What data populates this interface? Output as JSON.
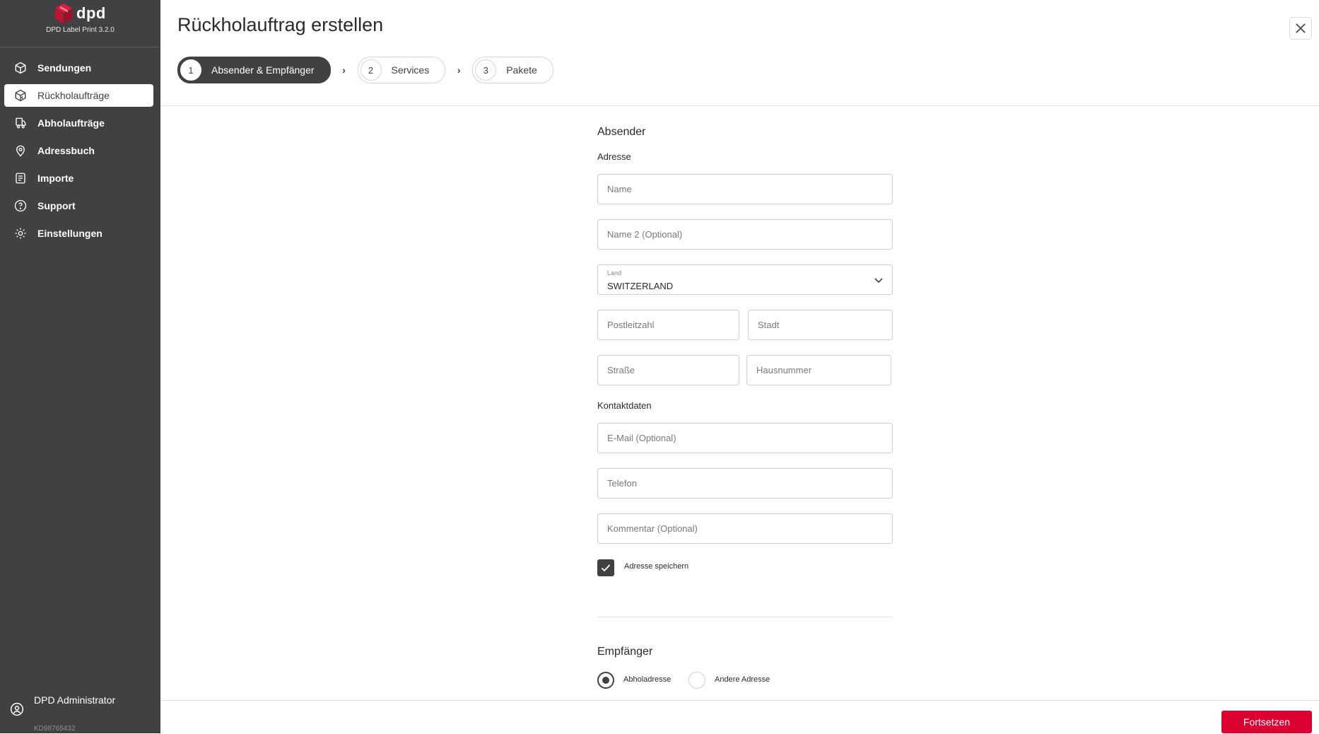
{
  "brand": {
    "logo_text": "dpd",
    "version": "DPD Label Print 3.2.0",
    "color": "#dc0032"
  },
  "sidebar": {
    "items": [
      {
        "label": "Sendungen",
        "icon": "package-icon"
      },
      {
        "label": "Rückholaufträge",
        "icon": "package-return-icon",
        "active": true
      },
      {
        "label": "Abholaufträge",
        "icon": "pickup-truck-icon"
      },
      {
        "label": "Adressbuch",
        "icon": "location-pin-icon"
      },
      {
        "label": "Importe",
        "icon": "import-list-icon"
      },
      {
        "label": "Support",
        "icon": "help-icon"
      },
      {
        "label": "Einstellungen",
        "icon": "gear-icon"
      }
    ],
    "user": {
      "name": "DPD Administrator",
      "customer_id": "KD98765432"
    }
  },
  "header": {
    "title": "Rückholauftrag erstellen",
    "steps": [
      {
        "number": "1",
        "label": "Absender & Empfänger",
        "active": true
      },
      {
        "number": "2",
        "label": "Services",
        "active": false
      },
      {
        "number": "3",
        "label": "Pakete",
        "active": false
      }
    ]
  },
  "form": {
    "sender_title": "Absender",
    "address_label": "Adresse",
    "fields": {
      "name": "Name",
      "name2": "Name 2 (Optional)",
      "postal_code": "Postleitzahl",
      "city": "Stadt",
      "street": "Straße",
      "house_number": "Hausnummer",
      "email": "E-Mail (Optional)",
      "phone": "Telefon",
      "comment": "Kommentar (Optional)"
    },
    "country": {
      "label": "Land",
      "value": "SWITZERLAND"
    },
    "contact_label": "Kontaktdaten",
    "save_address": {
      "label": "Adresse speichern",
      "checked": true
    },
    "recipient_title": "Empfänger",
    "recipient_options": [
      {
        "label": "Abholadresse",
        "selected": true
      },
      {
        "label": "Andere Adresse",
        "selected": false
      }
    ]
  },
  "footer": {
    "continue_label": "Fortsetzen"
  },
  "colors": {
    "sidebar_bg": "#414042",
    "accent_red": "#dc0032",
    "border": "#cfcfcf"
  }
}
